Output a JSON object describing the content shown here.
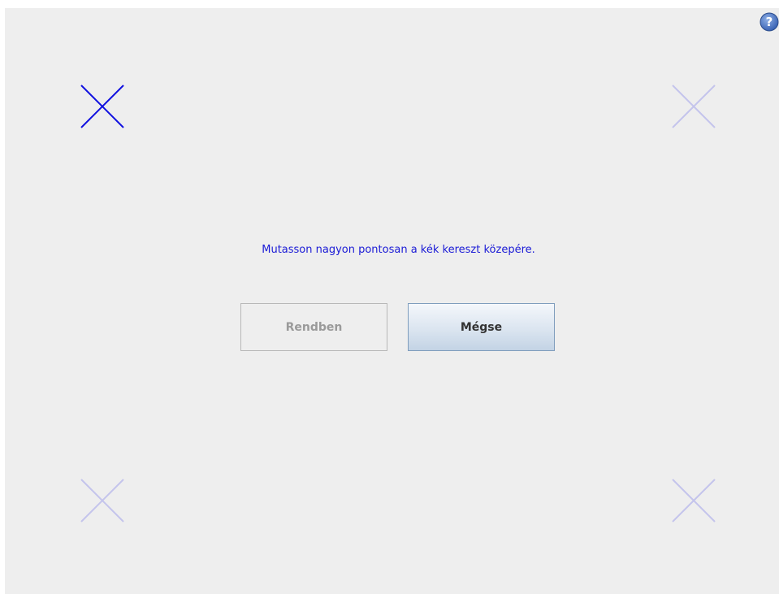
{
  "dialog": {
    "instruction": "Mutasson nagyon pontosan a kék kereszt közepére.",
    "ok_label": "Rendben",
    "cancel_label": "Mégse",
    "help_glyph": "?"
  },
  "targets": [
    {
      "corner": "top-left",
      "state": "active",
      "icon": "cross-icon"
    },
    {
      "corner": "top-right",
      "state": "inactive",
      "icon": "cross-icon"
    },
    {
      "corner": "bottom-left",
      "state": "inactive",
      "icon": "cross-icon"
    },
    {
      "corner": "bottom-right",
      "state": "inactive",
      "icon": "cross-icon"
    }
  ],
  "colors": {
    "active_cross": "#1010e0",
    "inactive_cross": "#c4c4ec",
    "text": "#1a1ad6",
    "background": "#eeeeee"
  }
}
